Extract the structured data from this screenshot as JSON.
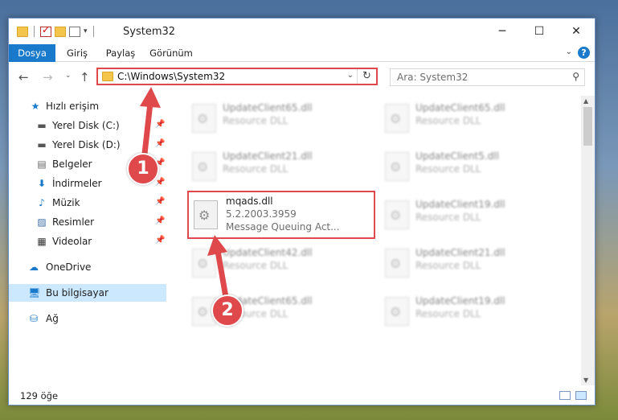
{
  "window": {
    "title": "System32"
  },
  "ribbon": {
    "tabs": [
      "Dosya",
      "Giriş",
      "Paylaş",
      "Görünüm"
    ]
  },
  "address": {
    "path": "C:\\Windows\\System32"
  },
  "search": {
    "placeholder": "Ara: System32"
  },
  "sidebar": {
    "items": [
      {
        "label": "Hızlı erişim",
        "icon": "star-icon"
      },
      {
        "label": "Yerel Disk (C:)",
        "icon": "drive-icon"
      },
      {
        "label": "Yerel Disk (D:)",
        "icon": "drive-icon"
      },
      {
        "label": "Belgeler",
        "icon": "document-icon"
      },
      {
        "label": "İndirmeler",
        "icon": "download-icon"
      },
      {
        "label": "Müzik",
        "icon": "music-icon"
      },
      {
        "label": "Resimler",
        "icon": "picture-icon"
      },
      {
        "label": "Videolar",
        "icon": "video-icon"
      },
      {
        "label": "OneDrive",
        "icon": "cloud-icon"
      },
      {
        "label": "Bu bilgisayar",
        "icon": "computer-icon"
      },
      {
        "label": "Ağ",
        "icon": "network-icon"
      }
    ]
  },
  "files": {
    "col1": [
      {
        "name": "UpdateClient65.dll",
        "desc": "Resource DLL"
      },
      {
        "name": "UpdateClient21.dll",
        "desc": "Resource DLL"
      },
      {
        "name": "mqads.dll",
        "desc": "5.2.2003.3959",
        "desc2": "Message Queuing Act..."
      },
      {
        "name": "UpdateClient42.dll",
        "desc": "Resource DLL"
      },
      {
        "name": "UpdateClient65.dll",
        "desc": "Resource DLL"
      }
    ],
    "col2": [
      {
        "name": "UpdateClient65.dll",
        "desc": "Resource DLL"
      },
      {
        "name": "UpdateClient5.dll",
        "desc": "Resource DLL"
      },
      {
        "name": "UpdateClient19.dll",
        "desc": "Resource DLL"
      },
      {
        "name": "UpdateClient21.dll",
        "desc": "Resource DLL"
      },
      {
        "name": "UpdateClient19.dll",
        "desc": "Resource DLL"
      }
    ]
  },
  "status": {
    "count": "129 öğe"
  },
  "annotations": {
    "step1": "1",
    "step2": "2"
  },
  "colors": {
    "accent": "#1979ca",
    "highlight": "#e0494b"
  }
}
